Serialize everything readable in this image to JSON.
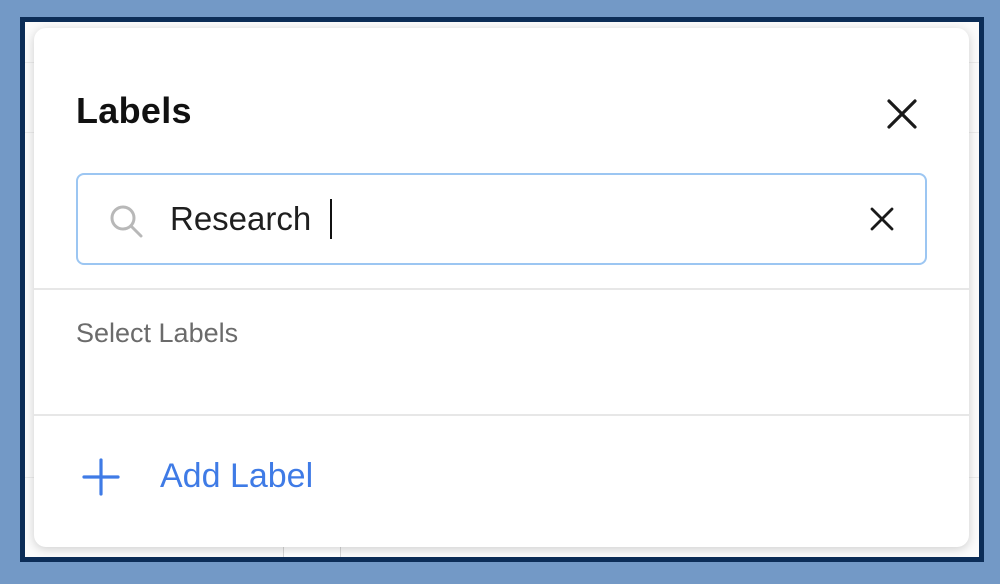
{
  "dialog": {
    "title": "Labels",
    "close_icon": "close-icon"
  },
  "search": {
    "value": "Research",
    "search_icon": "search-icon",
    "clear_icon": "clear-icon"
  },
  "section": {
    "select_labels": "Select Labels"
  },
  "actions": {
    "add_label": "Add Label",
    "add_icon": "plus-icon"
  },
  "colors": {
    "accent": "#3f7be6",
    "focus_border": "#9cc6f2",
    "outer_border": "#0c2d57",
    "page_background": "#7399c6"
  }
}
